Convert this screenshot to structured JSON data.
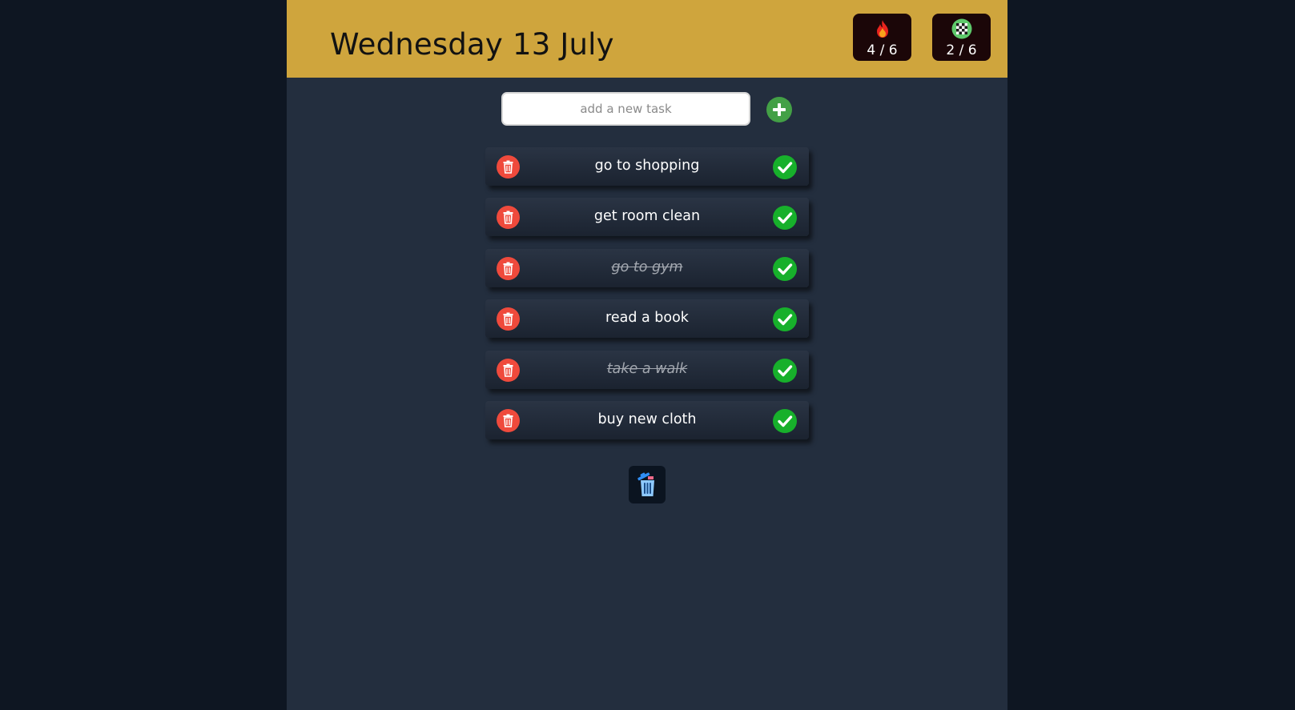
{
  "header": {
    "date": "Wednesday 13 July",
    "pending_counter": {
      "icon": "fire-icon",
      "value": "4 / 6"
    },
    "done_counter": {
      "icon": "checkered-flag-icon",
      "value": "2 / 6"
    }
  },
  "add_task": {
    "placeholder": "add a new task",
    "value": "",
    "button_icon": "plus-icon"
  },
  "tasks": [
    {
      "label": "go to shopping",
      "done": false
    },
    {
      "label": "get room clean",
      "done": false
    },
    {
      "label": "go to gym",
      "done": true
    },
    {
      "label": "read a book",
      "done": false
    },
    {
      "label": "take a walk",
      "done": true
    },
    {
      "label": "buy new cloth",
      "done": false
    }
  ],
  "clear_button": {
    "icon": "trash-can-icon"
  },
  "colors": {
    "header": "#cfa53d",
    "background": "#232e3e",
    "delete": "#ef4a3c",
    "complete": "#17b02b",
    "add": "#43a046"
  }
}
